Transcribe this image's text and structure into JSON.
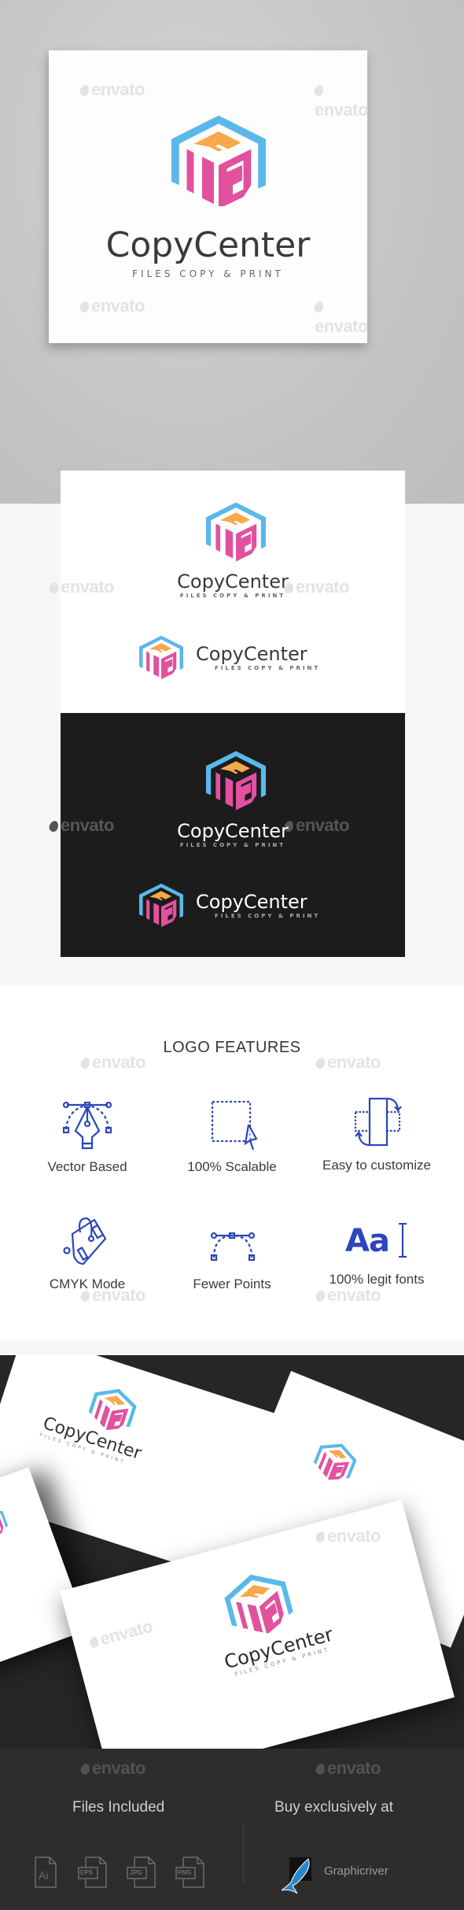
{
  "brand": {
    "name": "CopyCenter",
    "tagline": "FILES COPY & PRINT",
    "colors": {
      "blue": "#5ab8ea",
      "orange": "#f7a84a",
      "pink": "#e2519e",
      "text_dark": "#3a3a3a",
      "icon_blue": "#2d46b9"
    }
  },
  "watermark": {
    "text": "envato"
  },
  "features": {
    "title": "LOGO FEATURES",
    "items": [
      {
        "label": "Vector Based",
        "icon": "pen-tool-icon"
      },
      {
        "label": "100% Scalable",
        "icon": "scale-cursor-icon"
      },
      {
        "label": "Easy to customize",
        "icon": "flip-customize-icon"
      },
      {
        "label": "CMYK Mode",
        "icon": "paint-bucket-icon"
      },
      {
        "label": "Fewer Points",
        "icon": "bezier-curve-icon"
      },
      {
        "label": "100% legit fonts",
        "icon": "font-icon"
      }
    ],
    "font_icon_text": "Aa"
  },
  "footer": {
    "files_title": "Files Included",
    "files": [
      "Ai",
      "EPS",
      "JPG",
      "PNG"
    ],
    "buy_title": "Buy exclusively at",
    "marketplace": "Graphicriver"
  }
}
